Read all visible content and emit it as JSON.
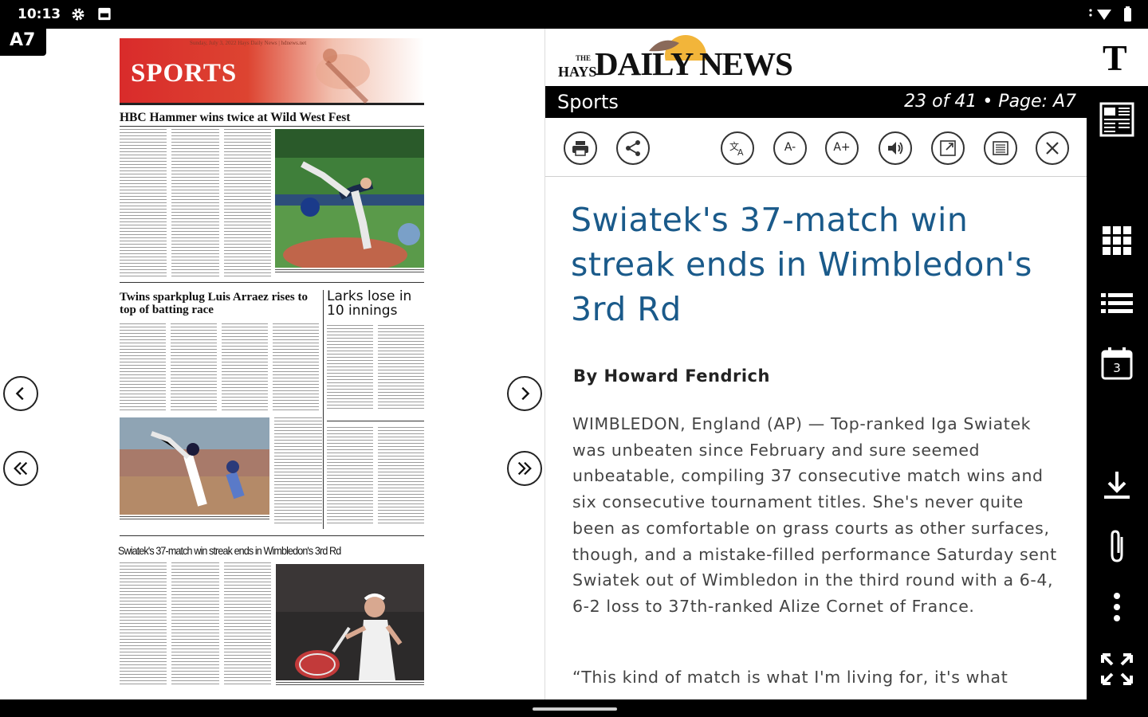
{
  "status_bar": {
    "time": "10:13"
  },
  "page_tag": "A7",
  "newspaper": {
    "banner_word": "SPORTS",
    "banner_top_text": "Sunday, July 3, 2022     Hays Daily News | hdnews.net",
    "headline_1": "HBC Hammer wins twice at Wild West Fest",
    "headline_2": "Twins sparkplug Luis Arraez rises to top of batting race",
    "headline_3": "Larks lose in 10 innings",
    "headline_4": "Swiatek's 37-match win streak ends in Wimbledon's 3rd Rd"
  },
  "article": {
    "masthead_the": "THE",
    "masthead_hays": "HAYS",
    "masthead_name": "DAILY NEWS",
    "section": "Sports",
    "counter": "23 of 41 • Page: A7",
    "tools": {
      "font_decrease": "A-",
      "font_increase": "A+"
    },
    "headline": "Swiatek's 37-match win streak ends in Wimbledon's 3rd Rd",
    "byline": "By Howard Fendrich",
    "body": "WIMBLEDON, England (AP) — Top-ranked Iga Swiatek was unbeaten since February and sure seemed unbeatable, compiling 37 consecutive match wins and six consecutive tournament titles. She's never quite been as comfortable on grass courts as other surfaces, though, and a mistake-filled performance Saturday sent Swiatek out of Wimbledon in the third round with a 6-4, 6-2 loss to 37th-ranked Alize Cornet of France.",
    "body_2": "“This kind of match is what I'm living for, it's what"
  },
  "right_rail": {
    "text_mode": "T",
    "calendar_day": "3"
  },
  "colors": {
    "headline_blue": "#1a5a8a",
    "banner_red": "#d92b2b",
    "bar_black": "#000000"
  }
}
